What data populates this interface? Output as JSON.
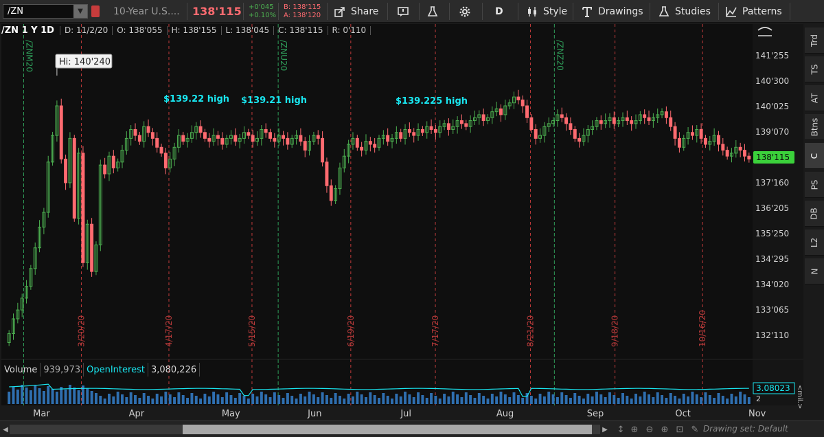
{
  "toolbar": {
    "symbol": "/ZN",
    "description": "10-Year U.S....",
    "last": "138'115",
    "change": "+0'045",
    "change_pct": "+0.10%",
    "bid": "B: 138'115",
    "ask": "A: 138'120",
    "share_label": "Share",
    "aggregation": "D",
    "style_label": "Style",
    "drawings_label": "Drawings",
    "studies_label": "Studies",
    "patterns_label": "Patterns"
  },
  "side_tabs": [
    "Trd",
    "TS",
    "AT",
    "Btns",
    "C",
    "PS",
    "DB",
    "L2",
    "N"
  ],
  "header": {
    "symbol": "/ZN 1 Y 1D",
    "date": "D: 11/2/20",
    "open": "O: 138'055",
    "high": "H: 138'155",
    "low": "L: 138'045",
    "close": "C: 138'115",
    "range": "R: 0'110"
  },
  "chart_data": {
    "type": "candlestick",
    "price_axis_labels": [
      "141'255",
      "140'300",
      "140'025",
      "139'070",
      "138'115",
      "137'160",
      "136'205",
      "135'250",
      "134'295",
      "134'020",
      "133'065",
      "132'110"
    ],
    "price_axis_values": [
      141.797,
      140.938,
      140.078,
      139.219,
      138.359,
      137.5,
      136.641,
      135.781,
      134.922,
      134.063,
      133.203,
      132.344
    ],
    "last_price_label": "138'115",
    "last_price": 138.359,
    "y_range": [
      131.6,
      142.4
    ],
    "months": [
      "Mar",
      "Apr",
      "May",
      "Jun",
      "Jul",
      "Aug",
      "Sep",
      "Oct",
      "Nov"
    ],
    "expiry_markers": [
      "/ZNM20",
      "/ZNU20",
      "/ZNZ20"
    ],
    "date_markers": [
      "3/20/20",
      "4/17/20",
      "5/15/20",
      "6/19/20",
      "7/17/20",
      "8/21/20",
      "9/18/20",
      "10/16/20"
    ],
    "annotations": [
      {
        "label": "Hi: 140'240",
        "kind": "callout"
      },
      {
        "label": "$139.22 high",
        "value": 139.22
      },
      {
        "label": "$139.21 high",
        "value": 139.21
      },
      {
        "label": "$139.225 high",
        "value": 139.225
      }
    ],
    "closes": [
      132.4,
      132.9,
      133.2,
      133.6,
      134.0,
      134.6,
      135.3,
      136.0,
      136.5,
      138.2,
      139.1,
      140.1,
      138.3,
      137.5,
      139.0,
      136.3,
      138.5,
      134.8,
      136.1,
      134.5,
      135.4,
      138.1,
      137.8,
      138.4,
      138.0,
      138.2,
      138.6,
      139.0,
      139.3,
      139.1,
      138.9,
      139.4,
      139.2,
      139.0,
      138.7,
      138.5,
      138.0,
      138.3,
      138.7,
      139.1,
      138.9,
      139.0,
      139.2,
      139.4,
      139.2,
      139.0,
      138.9,
      139.1,
      139.0,
      138.8,
      139.0,
      139.1,
      138.9,
      139.0,
      139.2,
      139.1,
      138.9,
      139.0,
      139.3,
      139.2,
      139.0,
      138.9,
      139.1,
      139.0,
      138.8,
      139.0,
      139.1,
      138.9,
      138.6,
      138.9,
      139.1,
      139.0,
      138.2,
      137.4,
      136.9,
      137.3,
      138.0,
      138.4,
      138.8,
      139.0,
      138.7,
      138.6,
      138.9,
      138.8,
      138.7,
      139.0,
      139.1,
      138.9,
      139.0,
      139.2,
      139.0,
      139.3,
      139.2,
      139.1,
      139.3,
      139.2,
      139.4,
      139.3,
      139.2,
      139.4,
      139.5,
      139.3,
      139.4,
      139.6,
      139.5,
      139.4,
      139.6,
      139.7,
      139.8,
      139.6,
      139.7,
      139.9,
      140.0,
      139.8,
      140.1,
      140.2,
      140.4,
      140.3,
      140.1,
      139.7,
      139.3,
      139.0,
      139.1,
      139.4,
      139.5,
      139.6,
      139.8,
      139.7,
      139.5,
      139.3,
      139.0,
      138.9,
      139.1,
      139.3,
      139.4,
      139.6,
      139.5,
      139.6,
      139.7,
      139.5,
      139.6,
      139.7,
      139.6,
      139.5,
      139.6,
      139.8,
      139.7,
      139.6,
      139.7,
      139.8,
      139.9,
      139.7,
      139.4,
      139.0,
      138.7,
      139.0,
      139.2,
      139.1,
      139.3,
      139.0,
      138.8,
      138.9,
      139.1,
      138.8,
      138.6,
      138.4,
      138.5,
      138.7,
      138.6,
      138.4,
      138.3
    ],
    "volume_header": {
      "label": "Volume",
      "value": "939,973",
      "oi_label": "OpenInterest",
      "oi_value": "3,080,226"
    },
    "oi_axis_label": "3.08023",
    "oi_axis_suffix": "2",
    "volume_axis_label": "<mil.>"
  },
  "bottom": {
    "drawing_set": "Drawing set: Default"
  },
  "colors": {
    "up": "#4caf50",
    "down": "#ff6b70",
    "accent": "#19e6f0",
    "last_tag": "#3bd13b",
    "vertical_month": "#c23b3b",
    "vertical_expiry": "#2f9e5a"
  }
}
